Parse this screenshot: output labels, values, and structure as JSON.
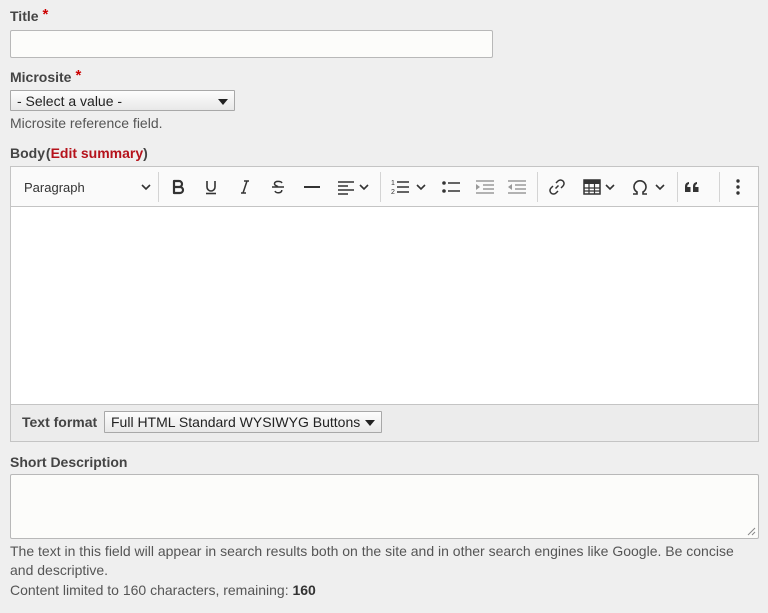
{
  "title_field": {
    "label": "Title",
    "required_mark": "*",
    "value": ""
  },
  "microsite_field": {
    "label": "Microsite",
    "required_mark": "*",
    "selected": "- Select a value -",
    "help": "Microsite reference field."
  },
  "body_field": {
    "label": "Body",
    "paren_open": "(",
    "edit_summary_link": "Edit summary",
    "paren_close": ")",
    "toolbar": {
      "heading_select": "Paragraph",
      "icons": [
        "bold-icon",
        "underline-icon",
        "italic-icon",
        "strikethrough-icon",
        "horizontal-line-icon",
        "align-icon",
        "numbered-list-icon",
        "bulleted-list-icon",
        "indent-icon",
        "outdent-icon",
        "link-icon",
        "table-icon",
        "special-characters-icon",
        "blockquote-icon",
        "more-options-icon"
      ]
    },
    "content": "",
    "text_format": {
      "label": "Text format",
      "selected": "Full HTML Standard WYSIWYG Buttons"
    }
  },
  "short_description_field": {
    "label": "Short Description",
    "value": "",
    "help_line1": "The text in this field will appear in search results both on the site and in other search engines like Google. Be concise",
    "help_line2": "and descriptive.",
    "limit_text": "Content limited to 160 characters, remaining: ",
    "remaining": "160"
  }
}
